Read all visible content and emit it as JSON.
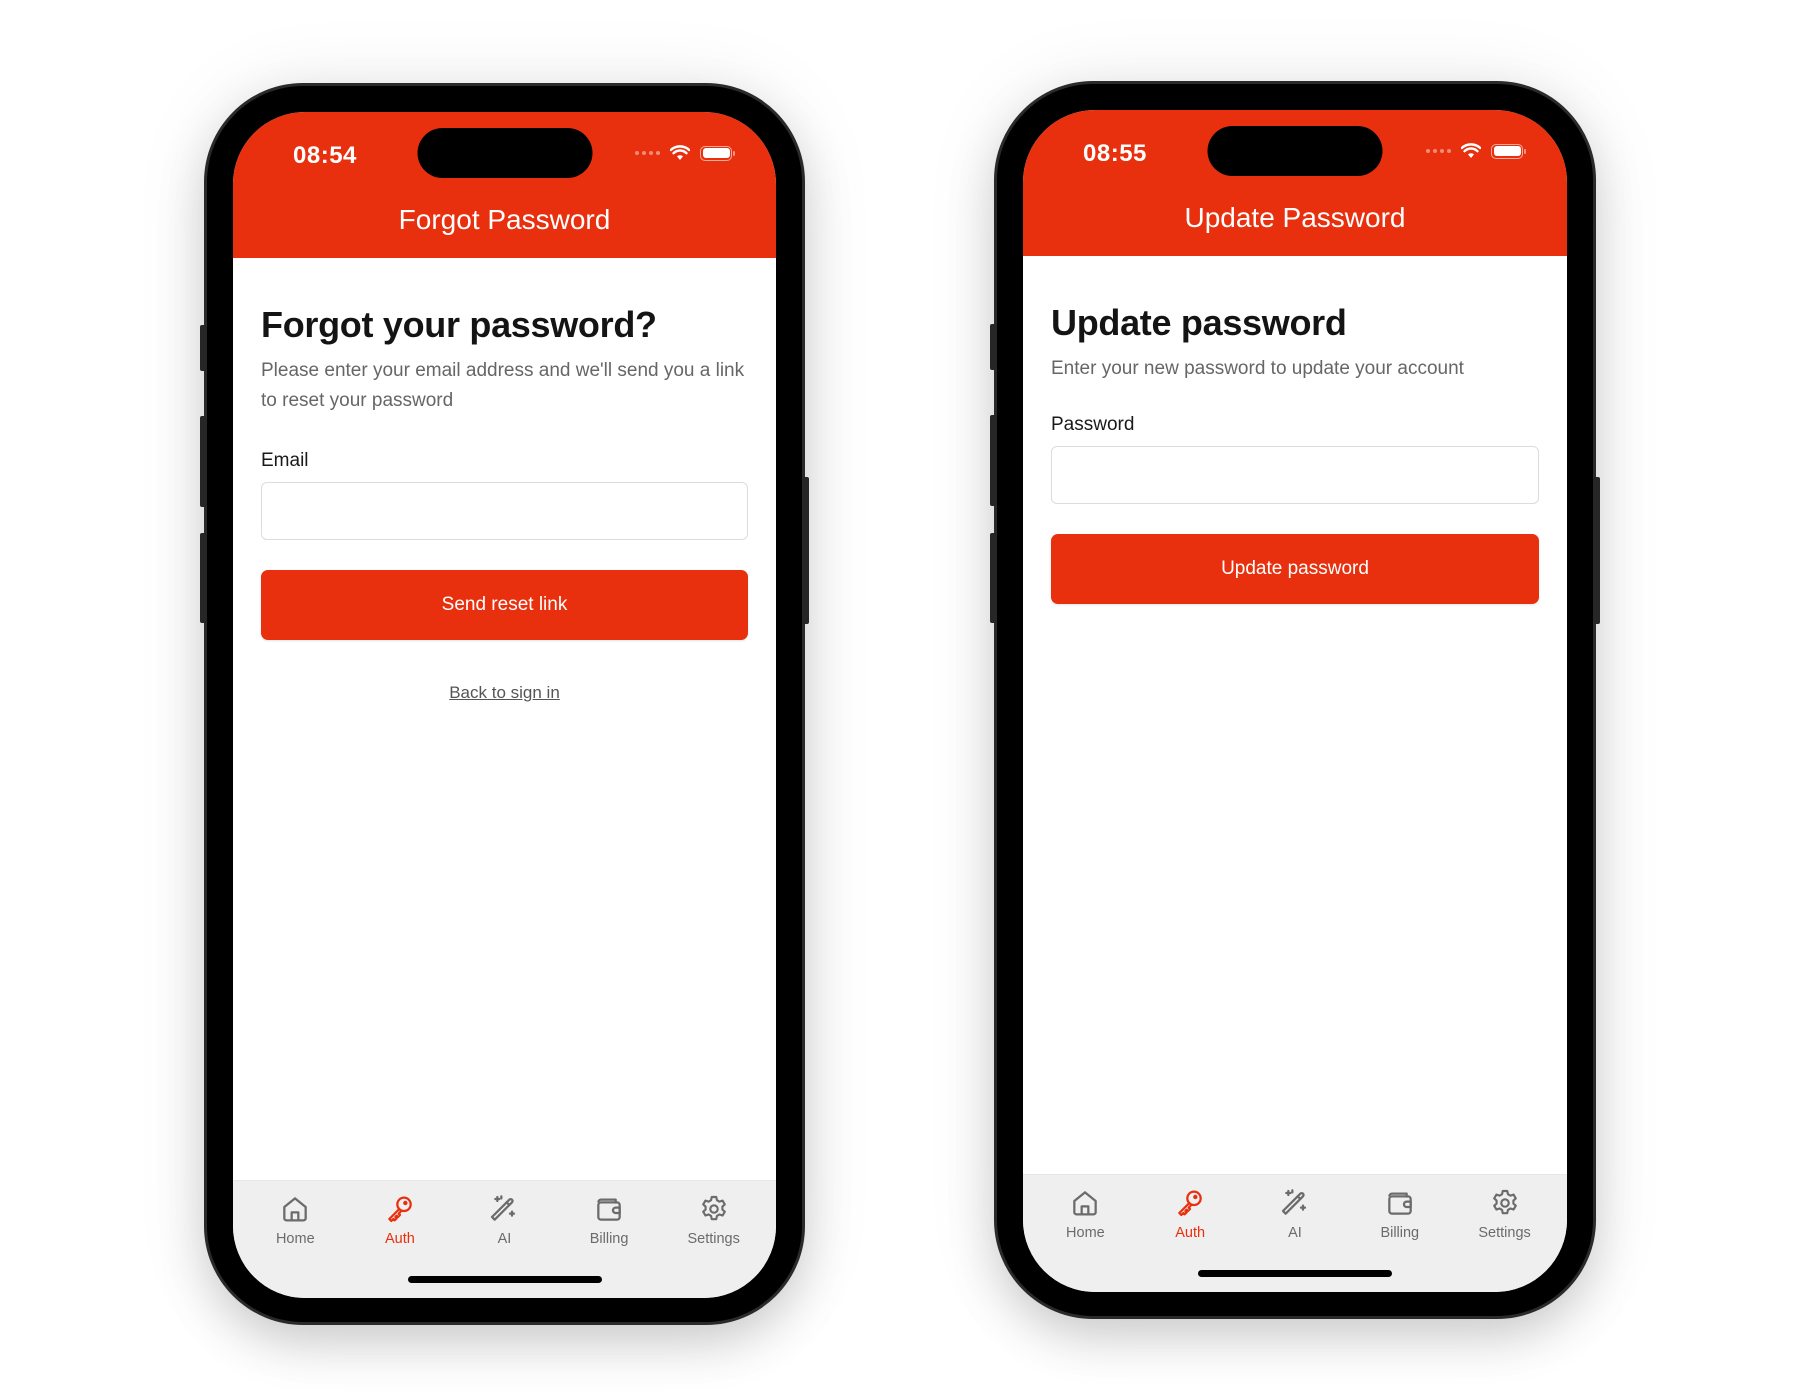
{
  "brand_color": "#E8300E",
  "screens": [
    {
      "status_bar": {
        "time": "08:54"
      },
      "nav_title": "Forgot Password",
      "heading": "Forgot your password?",
      "subtitle": "Please enter your email address and we'll send you a link to reset your password",
      "field_label": "Email",
      "field_value": "",
      "field_placeholder": "",
      "primary_button": "Send reset link",
      "secondary_link": "Back to sign in"
    },
    {
      "status_bar": {
        "time": "08:55"
      },
      "nav_title": "Update Password",
      "heading": "Update password",
      "subtitle": "Enter your new password to update your account",
      "field_label": "Password",
      "field_value": "",
      "field_placeholder": "",
      "primary_button": "Update password"
    }
  ],
  "tabbar": {
    "items": [
      {
        "label": "Home",
        "icon": "home-icon"
      },
      {
        "label": "Auth",
        "icon": "key-icon",
        "active": true
      },
      {
        "label": "AI",
        "icon": "magic-wand-icon"
      },
      {
        "label": "Billing",
        "icon": "wallet-icon"
      },
      {
        "label": "Settings",
        "icon": "gear-icon"
      }
    ],
    "active_color": "#E8300E",
    "inactive_color": "#6b6b6b"
  }
}
